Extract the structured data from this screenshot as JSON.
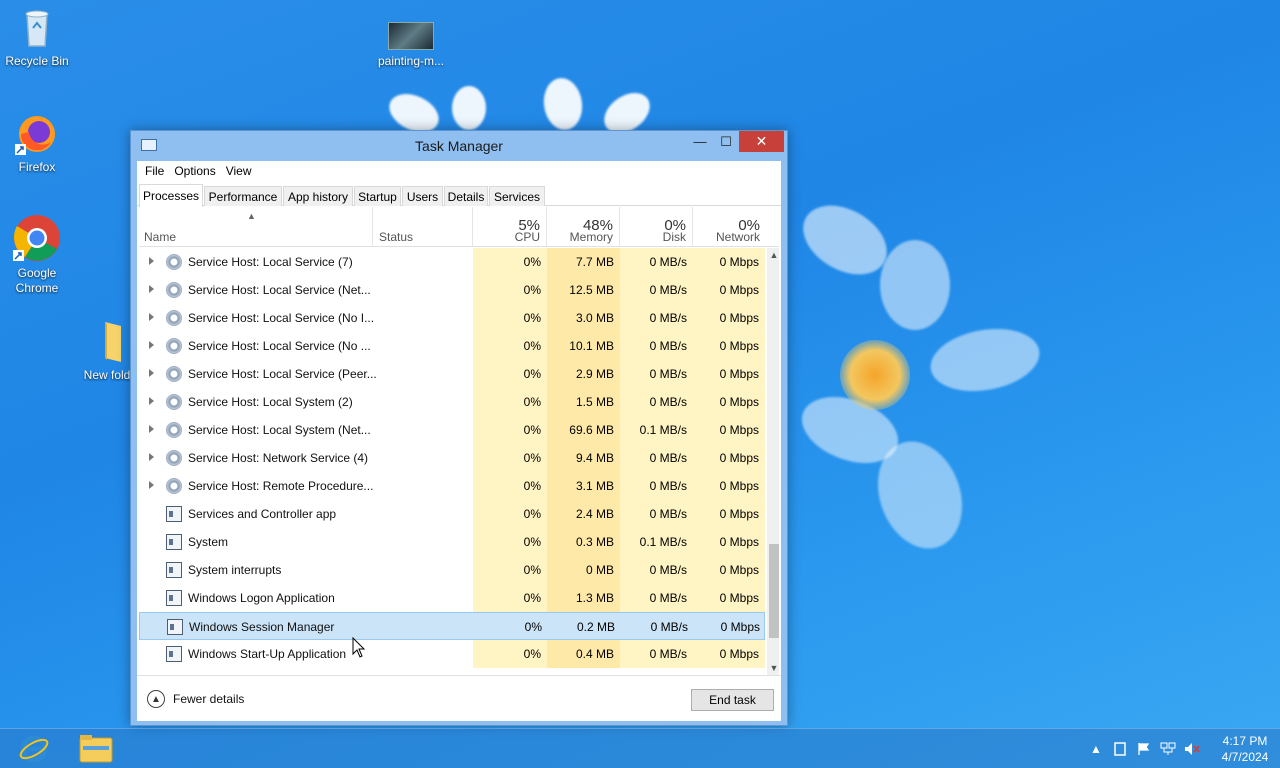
{
  "desktop": {
    "icons": [
      {
        "label": "Recycle Bin",
        "icon": "recycle-bin-icon"
      },
      {
        "label": "painting-m...",
        "icon": "image-thumbnail-icon"
      },
      {
        "label": "Firefox",
        "icon": "firefox-icon"
      },
      {
        "label": "Google Chrome",
        "icon": "chrome-icon"
      },
      {
        "label": "New fold",
        "icon": "folder-icon"
      }
    ]
  },
  "window": {
    "title": "Task Manager",
    "controls": {
      "minimize": "—",
      "maximize": "☐",
      "close": "✕"
    },
    "menu": [
      "File",
      "Options",
      "View"
    ],
    "tabs": [
      "Processes",
      "Performance",
      "App history",
      "Startup",
      "Users",
      "Details",
      "Services"
    ],
    "active_tab": "Processes",
    "columns": {
      "name": {
        "label": "Name"
      },
      "status": {
        "label": "Status"
      },
      "cpu": {
        "label": "CPU",
        "total": "5%"
      },
      "memory": {
        "label": "Memory",
        "total": "48%"
      },
      "disk": {
        "label": "Disk",
        "total": "0%"
      },
      "network": {
        "label": "Network",
        "total": "0%"
      }
    },
    "rows": [
      {
        "name": "Service Host: Local Service (7)",
        "status": "",
        "cpu": "0%",
        "memory": "7.7 MB",
        "disk": "0 MB/s",
        "network": "0 Mbps",
        "expandable": true,
        "icon": "gear"
      },
      {
        "name": "Service Host: Local Service (Net...",
        "status": "",
        "cpu": "0%",
        "memory": "12.5 MB",
        "disk": "0 MB/s",
        "network": "0 Mbps",
        "expandable": true,
        "icon": "gear"
      },
      {
        "name": "Service Host: Local Service (No I...",
        "status": "",
        "cpu": "0%",
        "memory": "3.0 MB",
        "disk": "0 MB/s",
        "network": "0 Mbps",
        "expandable": true,
        "icon": "gear"
      },
      {
        "name": "Service Host: Local Service (No ...",
        "status": "",
        "cpu": "0%",
        "memory": "10.1 MB",
        "disk": "0 MB/s",
        "network": "0 Mbps",
        "expandable": true,
        "icon": "gear"
      },
      {
        "name": "Service Host: Local Service (Peer...",
        "status": "",
        "cpu": "0%",
        "memory": "2.9 MB",
        "disk": "0 MB/s",
        "network": "0 Mbps",
        "expandable": true,
        "icon": "gear"
      },
      {
        "name": "Service Host: Local System (2)",
        "status": "",
        "cpu": "0%",
        "memory": "1.5 MB",
        "disk": "0 MB/s",
        "network": "0 Mbps",
        "expandable": true,
        "icon": "gear"
      },
      {
        "name": "Service Host: Local System (Net...",
        "status": "",
        "cpu": "0%",
        "memory": "69.6 MB",
        "disk": "0.1 MB/s",
        "network": "0 Mbps",
        "expandable": true,
        "icon": "gear"
      },
      {
        "name": "Service Host: Network Service (4)",
        "status": "",
        "cpu": "0%",
        "memory": "9.4 MB",
        "disk": "0 MB/s",
        "network": "0 Mbps",
        "expandable": true,
        "icon": "gear"
      },
      {
        "name": "Service Host: Remote Procedure...",
        "status": "",
        "cpu": "0%",
        "memory": "3.1 MB",
        "disk": "0 MB/s",
        "network": "0 Mbps",
        "expandable": true,
        "icon": "gear"
      },
      {
        "name": "Services and Controller app",
        "status": "",
        "cpu": "0%",
        "memory": "2.4 MB",
        "disk": "0 MB/s",
        "network": "0 Mbps",
        "expandable": false,
        "icon": "app"
      },
      {
        "name": "System",
        "status": "",
        "cpu": "0%",
        "memory": "0.3 MB",
        "disk": "0.1 MB/s",
        "network": "0 Mbps",
        "expandable": false,
        "icon": "app"
      },
      {
        "name": "System interrupts",
        "status": "",
        "cpu": "0%",
        "memory": "0 MB",
        "disk": "0 MB/s",
        "network": "0 Mbps",
        "expandable": false,
        "icon": "app"
      },
      {
        "name": "Windows Logon Application",
        "status": "",
        "cpu": "0%",
        "memory": "1.3 MB",
        "disk": "0 MB/s",
        "network": "0 Mbps",
        "expandable": false,
        "icon": "app"
      },
      {
        "name": "Windows Session Manager",
        "status": "",
        "cpu": "0%",
        "memory": "0.2 MB",
        "disk": "0 MB/s",
        "network": "0 Mbps",
        "expandable": false,
        "icon": "app",
        "selected": true
      },
      {
        "name": "Windows Start-Up Application",
        "status": "",
        "cpu": "0%",
        "memory": "0.4 MB",
        "disk": "0 MB/s",
        "network": "0 Mbps",
        "expandable": false,
        "icon": "app"
      }
    ],
    "footer": {
      "fewer_details": "Fewer details",
      "end_task": "End task"
    }
  },
  "taskbar": {
    "pinned": [
      "internet-explorer-icon",
      "file-explorer-icon"
    ],
    "tray": {
      "time": "4:17 PM",
      "date": "4/7/2024"
    }
  }
}
